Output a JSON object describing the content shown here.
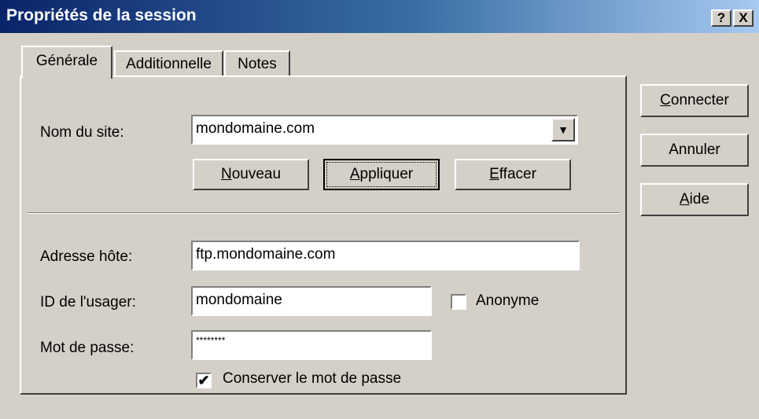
{
  "window": {
    "title": "Propriétés de la session",
    "help_glyph": "?",
    "close_glyph": "X"
  },
  "tabs": [
    {
      "label": "Générale"
    },
    {
      "label": "Additionnelle"
    },
    {
      "label": "Notes"
    }
  ],
  "site": {
    "label": "Nom du site:",
    "value": "mondomaine.com",
    "dropdown_glyph": "▼",
    "buttons": {
      "new": "Nouveau",
      "apply": "Appliquer",
      "delete": "Effacer"
    }
  },
  "host": {
    "label": "Adresse hôte:",
    "value": "ftp.mondomaine.com"
  },
  "user": {
    "label": "ID de l'usager:",
    "value": "mondomaine",
    "anonymous_label": "Anonyme",
    "anonymous_checked": false
  },
  "password": {
    "label": "Mot de passe:",
    "value": "********",
    "keep_label": "Conserver le mot de passe",
    "keep_checked": true,
    "check_glyph": "✔"
  },
  "side_buttons": {
    "connect": "Connecter",
    "cancel": "Annuler",
    "help": "Aide"
  }
}
